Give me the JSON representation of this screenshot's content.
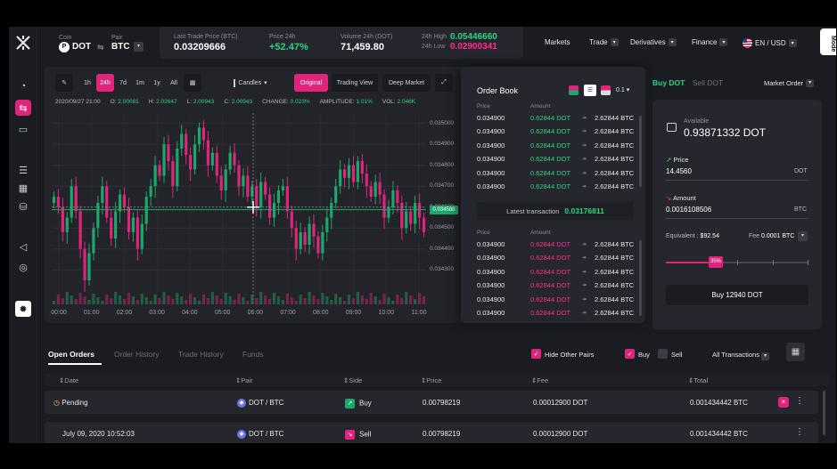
{
  "header": {
    "coin_label": "Coin",
    "coin_value": "DOT",
    "pair_label": "Pair",
    "pair_value": "BTC",
    "last_trade_label": "Last Trade Price (BTC)",
    "last_trade_value": "0.03209666",
    "price24_label": "Price 24h",
    "price24_value": "+52.47%",
    "volume_label": "Volume 24h (DOT)",
    "volume_value": "71,459.80",
    "high_label": "24h High",
    "high_value": "0.05446660",
    "low_label": "24h Low",
    "low_value": "0.02900341",
    "nav": [
      "Markets",
      "Trade",
      "Derivatives",
      "Finance"
    ],
    "lang": "EN / USD",
    "mode": "Mode"
  },
  "toolbar": {
    "timeframes": [
      "1h",
      "24h",
      "7d",
      "1m",
      "1y",
      "All"
    ],
    "active_timeframe": "24h",
    "chart_type": "Candles",
    "views": [
      "Original",
      "Trading View",
      "Deep Market"
    ]
  },
  "ohlc": {
    "date": "2020/09/27 21:00",
    "o_label": "O:",
    "o": "2.00081",
    "h_label": "H:",
    "h": "2.02647",
    "l_label": "L:",
    "l": "2.00943",
    "c_label": "C:",
    "c": "2.00943",
    "change_label": "CHANGE:",
    "change": "0.023%",
    "amplitude_label": "AMPLITUDE:",
    "amplitude": "1.01%",
    "vol_label": "VOL:",
    "vol": "2.046K"
  },
  "chart_data": {
    "type": "candlestick",
    "y_ticks": [
      "0.035000",
      "0.034900",
      "0.034800",
      "0.034700",
      "0.034600",
      "0.034500",
      "0.034400",
      "0.034300"
    ],
    "x_ticks": [
      "00:00",
      "01:00",
      "02:00",
      "03:00",
      "04:00",
      "05:00",
      "06:00",
      "07:00",
      "08:00",
      "09:00",
      "10:00",
      "11:00"
    ],
    "current_price": "0.034588",
    "current_price_value": 0.034588,
    "ylim": [
      0.03425,
      0.03505
    ],
    "colors": {
      "up": "#1ca86a",
      "down": "#e0247c"
    },
    "closes": [
      0.03465,
      0.0346,
      0.03448,
      0.03455,
      0.0347,
      0.03458,
      0.0344,
      0.03425,
      0.03438,
      0.0345,
      0.03462,
      0.0347,
      0.03455,
      0.03445,
      0.03458,
      0.03466,
      0.0346,
      0.03448,
      0.03455,
      0.0344,
      0.03452,
      0.03465,
      0.0347,
      0.0348,
      0.03475,
      0.0349,
      0.03482,
      0.0347,
      0.03488,
      0.03495,
      0.03485,
      0.03478,
      0.0349,
      0.03498,
      0.03492,
      0.0348,
      0.03486,
      0.03475,
      0.03468,
      0.03478,
      0.03486,
      0.0348,
      0.0347,
      0.03475,
      0.03465,
      0.0347,
      0.0346,
      0.03472,
      0.03466,
      0.03455,
      0.03462,
      0.03468,
      0.0347,
      0.03458,
      0.0345,
      0.0344,
      0.03448,
      0.03442,
      0.03452,
      0.03446,
      0.03438,
      0.03448,
      0.03455,
      0.03462,
      0.0347,
      0.03478,
      0.03474,
      0.0348,
      0.03472,
      0.03482,
      0.03476,
      0.0347,
      0.03465,
      0.03472,
      0.03466,
      0.03455,
      0.0346,
      0.03468,
      0.03462,
      0.0345,
      0.03458,
      0.03452,
      0.03462,
      0.03455,
      0.03448
    ]
  },
  "orderbook": {
    "title": "Order Book",
    "precision": "0.1",
    "price_label": "Price",
    "amount_label": "Amount",
    "asks": [
      {
        "price": "0.034900",
        "amount": "0.62844 DOT",
        "total": "2.62844 BTC"
      },
      {
        "price": "0.034900",
        "amount": "0.62844 DOT",
        "total": "2.62844 BTC"
      },
      {
        "price": "0.034900",
        "amount": "0.62844 DOT",
        "total": "2.62844 BTC"
      },
      {
        "price": "0.034900",
        "amount": "0.62844 DOT",
        "total": "2.62844 BTC"
      },
      {
        "price": "0.034900",
        "amount": "0.62844 DOT",
        "total": "2.62844 BTC"
      },
      {
        "price": "0.034900",
        "amount": "0.62844 DOT",
        "total": "2.62844 BTC"
      }
    ],
    "latest_label": "Latest transaction",
    "latest_value": "0.03176811",
    "bids": [
      {
        "price": "0.034900",
        "amount": "0.62844 DOT",
        "total": "2.62844 BTC"
      },
      {
        "price": "0.034900",
        "amount": "0.62844 DOT",
        "total": "2.62844 BTC"
      },
      {
        "price": "0.034900",
        "amount": "0.62844 DOT",
        "total": "2.62844 BTC"
      },
      {
        "price": "0.034900",
        "amount": "0.62844 DOT",
        "total": "2.62844 BTC"
      },
      {
        "price": "0.034900",
        "amount": "0.62844 DOT",
        "total": "2.62844 BTC"
      },
      {
        "price": "0.034900",
        "amount": "0.62844 DOT",
        "total": "2.62844 BTC"
      }
    ]
  },
  "trade": {
    "buy_tab": "Buy DOT",
    "sell_tab": "Sell DOT",
    "order_type": "Market Order",
    "available_label": "Available",
    "available_value": "0.93871332 DOT",
    "price_label": "Price",
    "price_value": "14.4560",
    "price_unit": "DOT",
    "amount_label": "Amount",
    "amount_value": "0.0016108506",
    "amount_unit": "BTC",
    "equivalent_label": "Equivalent :",
    "equivalent_value": "$92.54",
    "fee_label": "Fee",
    "fee_value": "0.0001 BTC",
    "slider_label": "35%",
    "slider_level": 0.35,
    "buy_button": "Buy 12940 DOT"
  },
  "orders": {
    "tabs": [
      "Open Orders",
      "Order History",
      "Trade History",
      "Funds"
    ],
    "hide_other_pairs": "Hide Other Pairs",
    "buy_filter": "Buy",
    "sell_filter": "Sell",
    "transactions": "All Transactions",
    "columns": [
      "Date",
      "Pair",
      "Side",
      "Price",
      "Fee",
      "Total"
    ],
    "rows": [
      {
        "date": "Pending",
        "pair": "DOT / BTC",
        "side": "Buy",
        "price": "0.00798219",
        "fee": "0.00012900 DOT",
        "total": "0.001434442 BTC"
      },
      {
        "date": "July 09, 2020 10:52:03",
        "pair": "DOT / BTC",
        "side": "Sell",
        "price": "0.00798219",
        "fee": "0.00012900 DOT",
        "total": "0.001434442 BTC"
      }
    ]
  }
}
